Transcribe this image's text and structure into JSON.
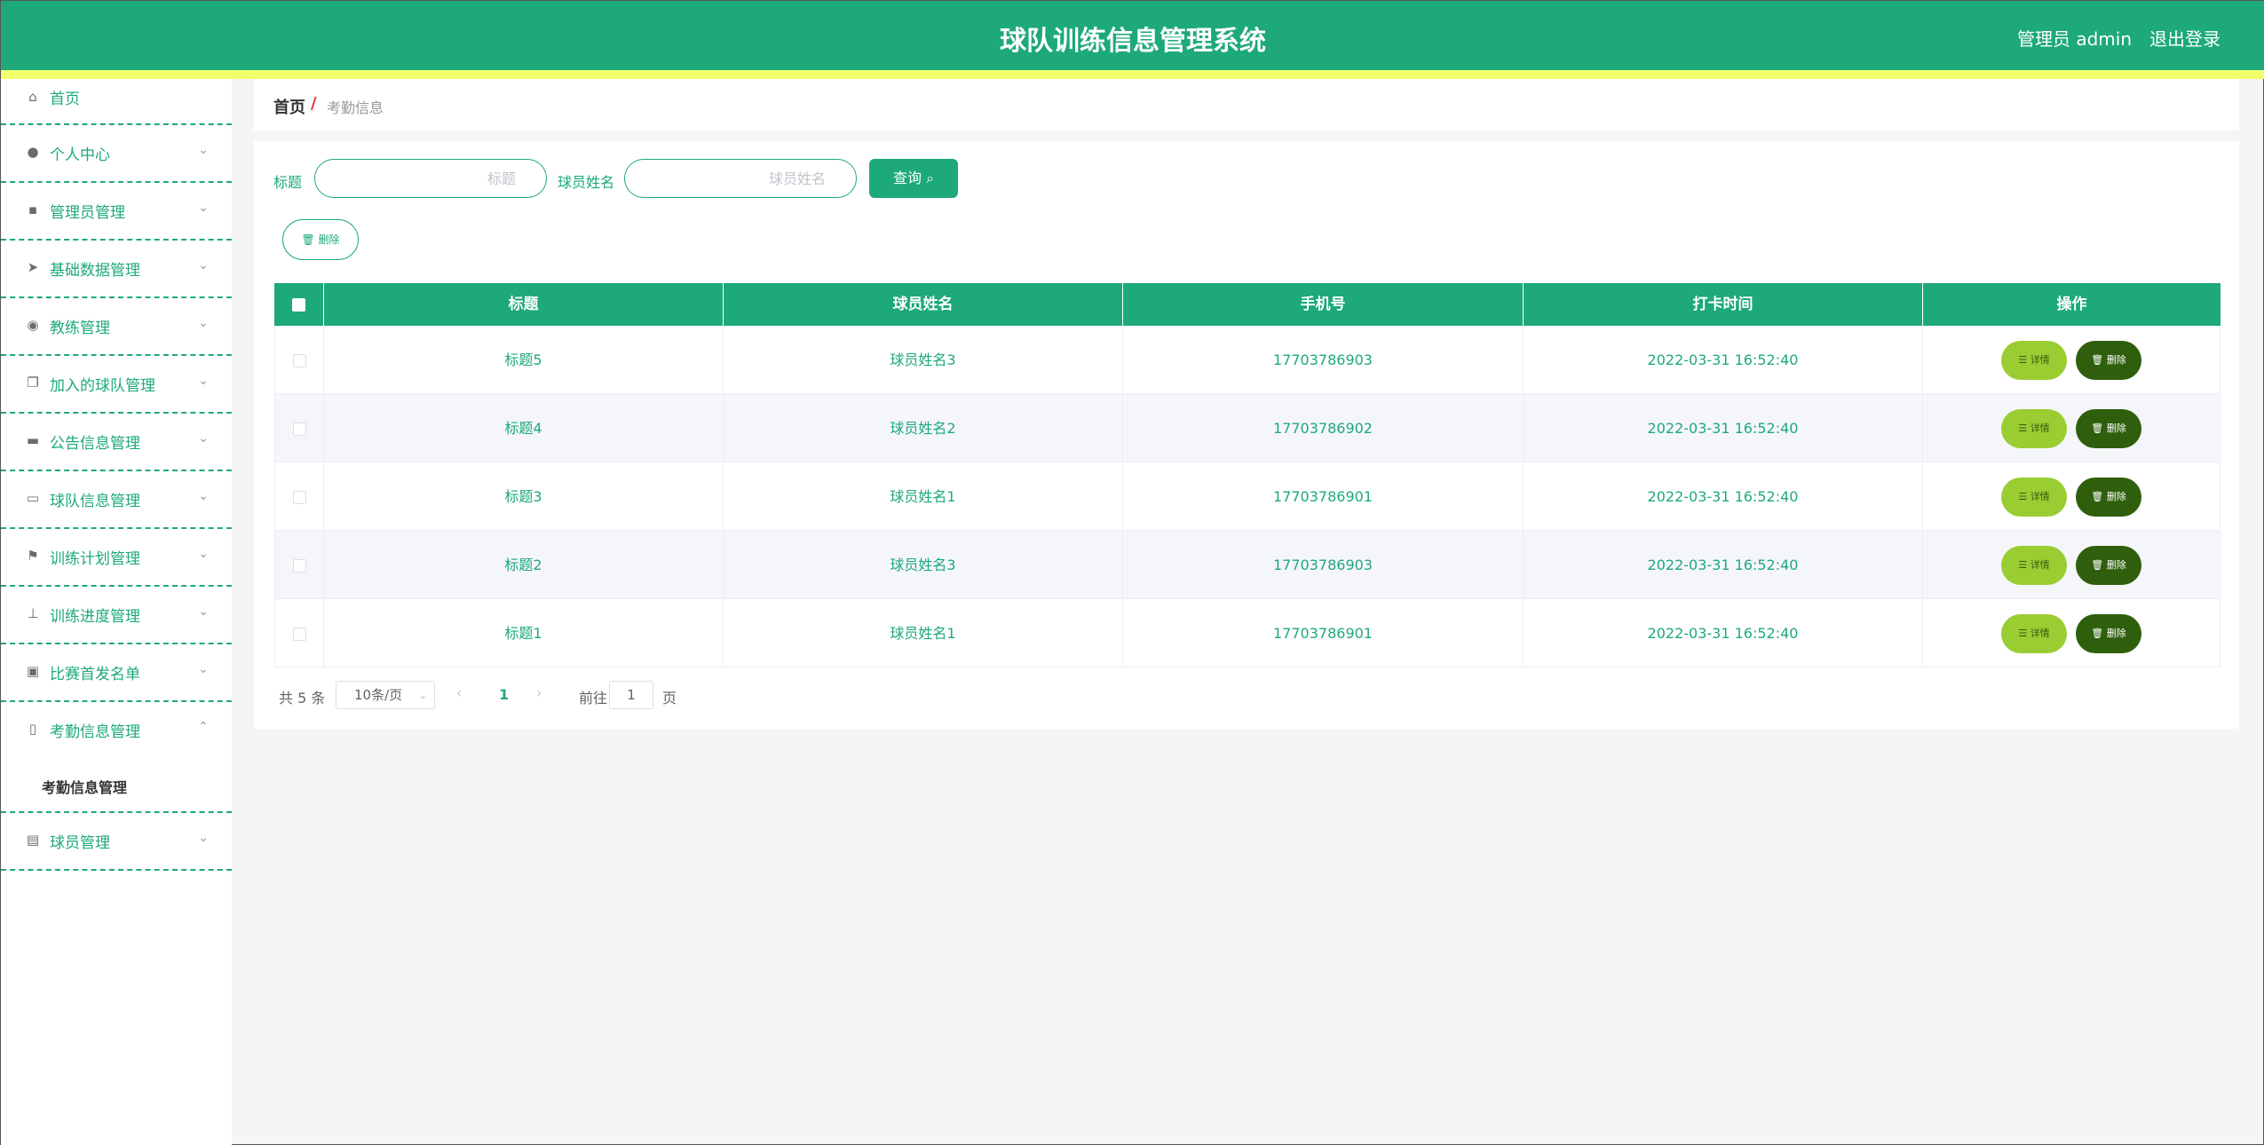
{
  "header": {
    "title": "球队训练信息管理系统",
    "user": "管理员 admin",
    "logout": "退出登录"
  },
  "sidebar": {
    "items": [
      {
        "label": "首页",
        "icon": "home-icon"
      },
      {
        "label": "个人中心",
        "icon": "user-icon"
      },
      {
        "label": "管理员管理",
        "icon": "clipboard-icon"
      },
      {
        "label": "基础数据管理",
        "icon": "send-icon"
      },
      {
        "label": "教练管理",
        "icon": "location-icon"
      },
      {
        "label": "加入的球队管理",
        "icon": "copy-icon"
      },
      {
        "label": "公告信息管理",
        "icon": "briefcase-icon"
      },
      {
        "label": "球队信息管理",
        "icon": "message-icon"
      },
      {
        "label": "训练计划管理",
        "icon": "flag-icon"
      },
      {
        "label": "训练进度管理",
        "icon": "stamp-icon"
      },
      {
        "label": "比赛首发名单",
        "icon": "id-card-icon"
      },
      {
        "label": "考勤信息管理",
        "icon": "microphone-icon"
      },
      {
        "label": "球员管理",
        "icon": "clipboard-list-icon"
      }
    ],
    "submenu": {
      "label": "考勤信息管理"
    }
  },
  "breadcrumb": {
    "home": "首页",
    "sep": "/",
    "current": "考勤信息"
  },
  "search": {
    "title_label": "标题",
    "title_placeholder": "标题",
    "name_label": "球员姓名",
    "name_placeholder": "球员姓名",
    "query_button": "查询"
  },
  "bulk_delete": "删除",
  "table": {
    "headers": [
      "标题",
      "球员姓名",
      "手机号",
      "打卡时间",
      "操作"
    ],
    "rows": [
      {
        "title": "标题5",
        "name": "球员姓名3",
        "phone": "17703786903",
        "time": "2022-03-31 16:52:40"
      },
      {
        "title": "标题4",
        "name": "球员姓名2",
        "phone": "17703786902",
        "time": "2022-03-31 16:52:40"
      },
      {
        "title": "标题3",
        "name": "球员姓名1",
        "phone": "17703786901",
        "time": "2022-03-31 16:52:40"
      },
      {
        "title": "标题2",
        "name": "球员姓名3",
        "phone": "17703786903",
        "time": "2022-03-31 16:52:40"
      },
      {
        "title": "标题1",
        "name": "球员姓名1",
        "phone": "17703786901",
        "time": "2022-03-31 16:52:40"
      }
    ],
    "detail_label": "详情",
    "delete_label": "删除"
  },
  "pagination": {
    "total": "共 5 条",
    "page_size": "10条/页",
    "current_page": "1",
    "goto_label": "前往",
    "goto_value": "1",
    "page_suffix": "页"
  },
  "colors": {
    "primary": "#1da97a",
    "accent_stripe": "#f3ff6a",
    "detail_btn": "#9acd32",
    "delete_btn": "#2f5f0d"
  }
}
